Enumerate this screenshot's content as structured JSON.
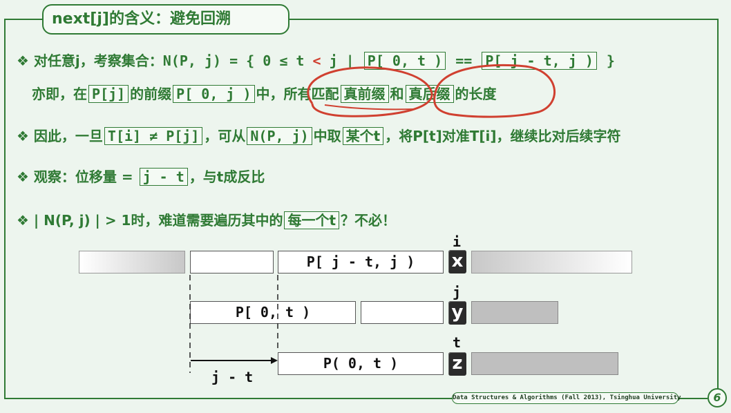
{
  "title": "next[j]的含义：避免回溯",
  "bullets": {
    "b1_prefix": "对任意j，考察集合：",
    "b1_set_left": "N(P, j) = { 0 ≤ t ",
    "b1_lt": "<",
    "b1_mid": " j | ",
    "b1_box1": "P[ 0, t )",
    "b1_eq": " == ",
    "b1_box2": "P[ j - t, j )",
    "b1_end": " }",
    "l2_a": "亦即，在",
    "l2_box1": "P[j]",
    "l2_b": "的前缀",
    "l2_box2": "P[ 0, j )",
    "l2_c": "中，所有匹配",
    "l2_box3": "真前缀",
    "l2_d": "和",
    "l2_box4": "真后缀",
    "l2_e": "的长度",
    "b2_a": "因此，一旦",
    "b2_box1": "T[i] ≠ P[j]",
    "b2_b": "，可从",
    "b2_box2": "N(P, j)",
    "b2_c": "中取",
    "b2_box3": "某个t",
    "b2_d": "，将P[t]对准T[i]，继续比对后续字符",
    "b3_a": "观察：位移量 = ",
    "b3_box": "j - t",
    "b3_b": "，与t成反比",
    "b4_a": "| N(P, j) | > 1时，难道需要遍历其中的",
    "b4_box": "每一个t",
    "b4_b": "？不必！"
  },
  "diagram": {
    "row1_label": "P[ j - t, j )",
    "row2_label": "P[ 0, t )",
    "row3_label": "P( 0, t )",
    "char_x": "x",
    "char_y": "y",
    "char_z": "z",
    "idx_i": "i",
    "idx_j": "j",
    "idx_t": "t",
    "shift_label": "j - t"
  },
  "footer": "Data Structures & Algorithms (Fall 2013), Tsinghua University",
  "page_number": "6",
  "colors": {
    "accent": "#2f7a34",
    "annotation": "#d04030"
  }
}
